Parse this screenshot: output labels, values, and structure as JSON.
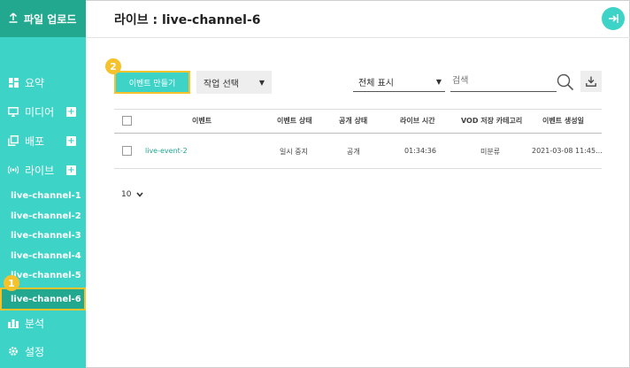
{
  "sidebar": {
    "upload_label": "파일 업로드",
    "nav": [
      {
        "label": "요약",
        "icon": "dashboard-icon",
        "has_add": false
      },
      {
        "label": "미디어",
        "icon": "monitor-icon",
        "has_add": true
      },
      {
        "label": "배포",
        "icon": "copy-icon",
        "has_add": true
      },
      {
        "label": "라이브",
        "icon": "broadcast-icon",
        "has_add": true
      },
      {
        "label": "분석",
        "icon": "bar-chart-icon",
        "has_add": false
      },
      {
        "label": "설정",
        "icon": "gear-icon",
        "has_add": false
      }
    ],
    "channels": [
      "live-channel-1",
      "live-channel-2",
      "live-channel-3",
      "live-channel-4",
      "live-channel-5",
      "live-channel-6"
    ],
    "active_channel": "live-channel-6"
  },
  "header": {
    "title": "라이브 : live-channel-6"
  },
  "markers": {
    "one": "1",
    "two": "2"
  },
  "toolbar": {
    "create_label": "이벤트 만들기",
    "action_label": "작업 선택",
    "filter_label": "전체 표시",
    "search_placeholder": "검색"
  },
  "table": {
    "headers": {
      "event": "이벤트",
      "status": "이벤트 상태",
      "visibility": "공개 상태",
      "live_time": "라이브 시간",
      "vod_category": "VOD 저장 카테고리",
      "created": "이벤트 생성일"
    },
    "rows": [
      {
        "event": "live-event-2",
        "status": "일시 중지",
        "visibility": "공개",
        "live_time": "01:34:36",
        "vod_category": "미분류",
        "created": "2021-03-08 11:45..."
      }
    ]
  },
  "pagination": {
    "page_size": "10"
  },
  "colors": {
    "accent": "#3dd3c7",
    "accent_dark": "#21a88f",
    "highlight": "#f5c22b"
  }
}
